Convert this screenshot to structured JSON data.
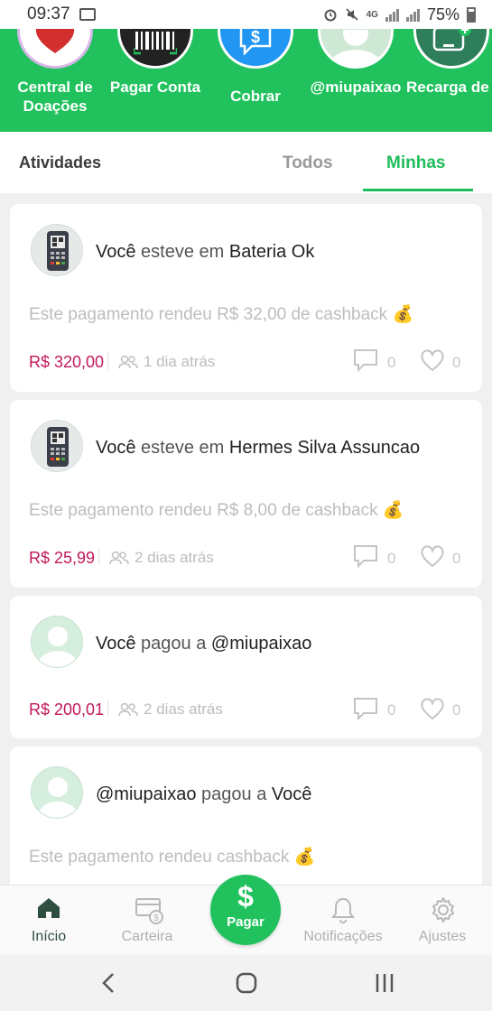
{
  "status_bar": {
    "time": "09:37",
    "battery": "75%",
    "network": "4G"
  },
  "quick_actions": [
    {
      "label": "Central de Doações",
      "icon": "heart-icon",
      "bg": "#c62828"
    },
    {
      "label": "Pagar Conta",
      "icon": "barcode-icon",
      "bg": "#222222"
    },
    {
      "label": "Cobrar",
      "icon": "chat-dollar-icon",
      "bg": "#2196f3"
    },
    {
      "label": "@miupaixao",
      "icon": "user-avatar-icon",
      "bg": "#cfe8d6"
    },
    {
      "label": "Recarga de Celular",
      "icon": "phone-plus-icon",
      "bg": "#2e7d5b"
    }
  ],
  "activity": {
    "title": "Atividades",
    "tabs": [
      "Todos",
      "Minhas"
    ],
    "selected_tab": "Minhas"
  },
  "feed": [
    {
      "subject": "Você",
      "verb": "esteve em",
      "object": "Bateria Ok",
      "note": "Este pagamento rendeu R$ 32,00 de cashback 💰",
      "amount": "R$ 320,00",
      "ago": "1 dia atrás",
      "comments": "0",
      "likes": "0",
      "avatar": "pos-terminal-icon"
    },
    {
      "subject": "Você",
      "verb": "esteve em",
      "object": "Hermes Silva Assuncao",
      "note": "Este pagamento rendeu R$ 8,00 de cashback 💰",
      "amount": "R$ 25,99",
      "ago": "2 dias atrás",
      "comments": "0",
      "likes": "0",
      "avatar": "pos-terminal-icon"
    },
    {
      "subject": "Você",
      "verb": "pagou a",
      "object": "@miupaixao",
      "amount": "R$ 200,01",
      "ago": "2 dias atrás",
      "comments": "0",
      "likes": "0",
      "avatar": "user-avatar-icon"
    },
    {
      "subject": "@miupaixao",
      "verb": "pagou a",
      "object": "Você",
      "note": "Este pagamento rendeu cashback 💰",
      "avatar": "user-avatar-icon"
    }
  ],
  "bottom_nav": {
    "inicio": "Início",
    "carteira": "Carteira",
    "pagar_symbol": "$",
    "pagar": "Pagar",
    "notificacoes": "Notificações",
    "ajustes": "Ajustes",
    "active": "Início"
  },
  "colors": {
    "brand_green": "#21c25e",
    "amount_red": "#c2185b",
    "tab_active": "#1fbd5a"
  }
}
